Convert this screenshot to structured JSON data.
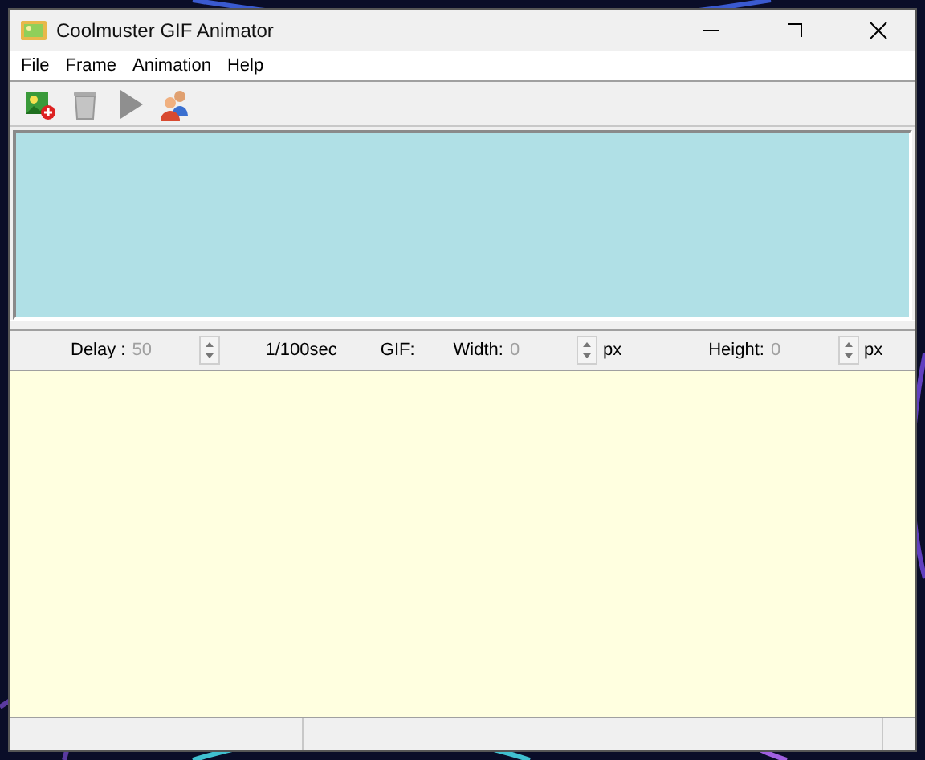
{
  "window": {
    "title": "Coolmuster GIF Animator"
  },
  "menu": [
    {
      "label": "File"
    },
    {
      "label": "Frame"
    },
    {
      "label": "Animation"
    },
    {
      "label": "Help"
    }
  ],
  "toolbar": [
    {
      "kind": "add-image"
    },
    {
      "kind": "delete"
    },
    {
      "kind": "play"
    },
    {
      "kind": "users"
    }
  ],
  "settings": [
    {
      "kind": "field",
      "label": "Delay :",
      "value": "50",
      "disabled": true
    },
    {
      "kind": "text",
      "label": "1/100sec"
    },
    {
      "kind": "text",
      "label": "GIF:"
    },
    {
      "kind": "field",
      "label": "Width:",
      "value": "0",
      "unit": "px",
      "disabled": true
    },
    {
      "kind": "field",
      "label": "Height:",
      "value": "0",
      "unit": "px",
      "disabled": true
    }
  ]
}
